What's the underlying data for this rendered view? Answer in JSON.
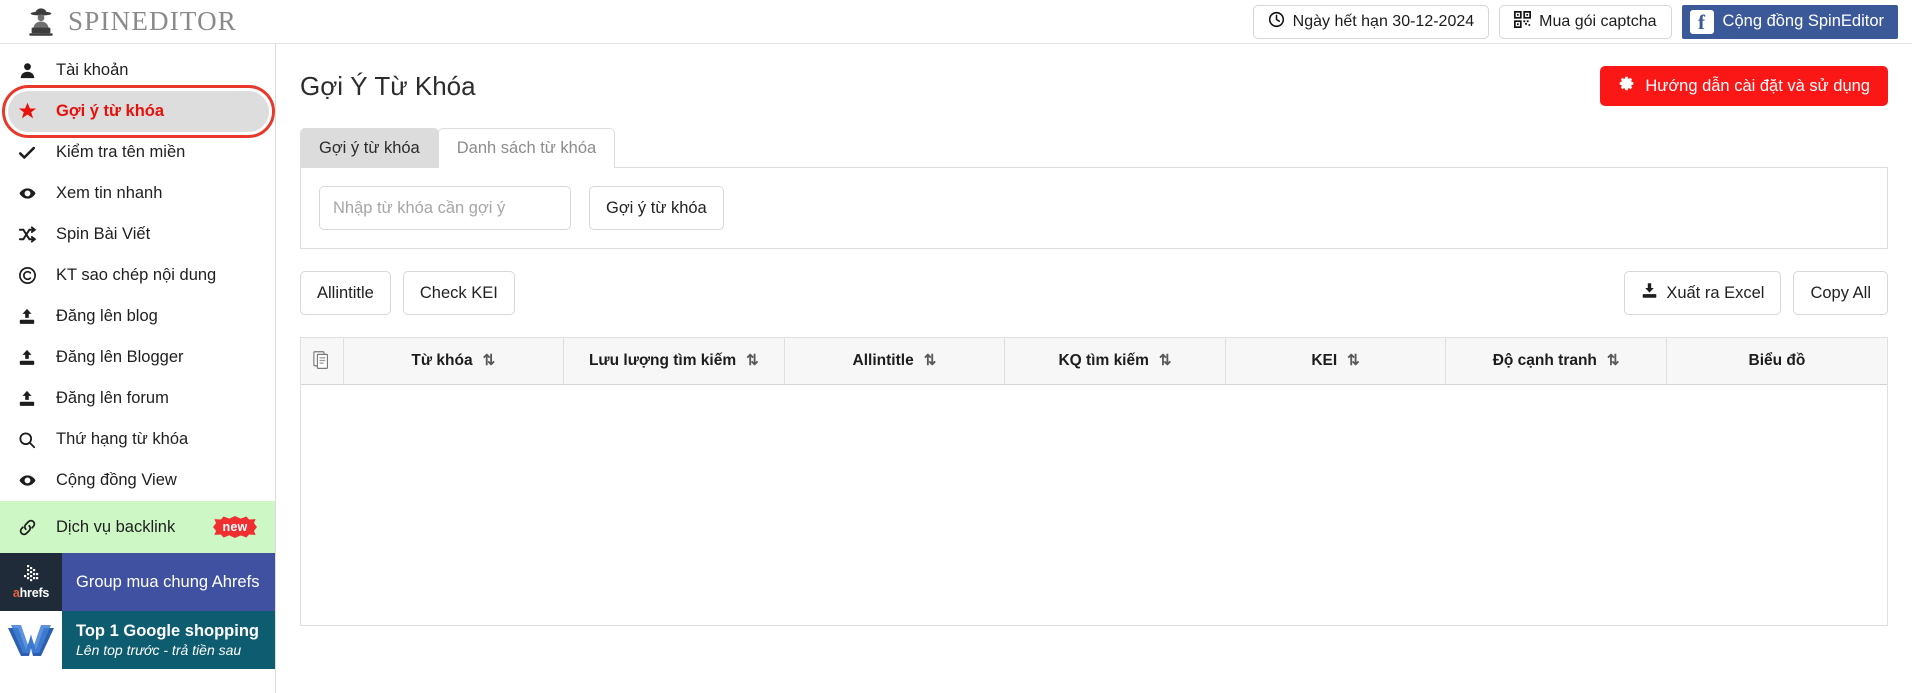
{
  "header": {
    "brand": "SPINEDITOR",
    "logo_icon": "spy-laptop-icon",
    "expiry_button": {
      "label": "Ngày hết hạn 30-12-2024",
      "icon": "clock-icon"
    },
    "captcha_button": {
      "label": "Mua gói captcha",
      "icon": "qr-code-icon"
    },
    "facebook_button": {
      "label": "Cộng đồng SpinEditor",
      "icon": "facebook-icon",
      "mark": "f",
      "color": "#3b5998"
    }
  },
  "sidebar": {
    "items": [
      {
        "label": "Tài khoản",
        "icon": "user-icon",
        "active": false
      },
      {
        "label": "Gợi ý từ khóa",
        "icon": "star-icon",
        "active": true
      },
      {
        "label": "Kiểm tra tên miền",
        "icon": "check-icon",
        "active": false
      },
      {
        "label": "Xem tin nhanh",
        "icon": "eye-icon",
        "active": false
      },
      {
        "label": "Spin Bài Viết",
        "icon": "shuffle-icon",
        "active": false
      },
      {
        "label": "KT sao chép nội dung",
        "icon": "copyright-icon",
        "active": false
      },
      {
        "label": "Đăng lên blog",
        "icon": "upload-icon",
        "active": false
      },
      {
        "label": "Đăng lên Blogger",
        "icon": "upload-icon",
        "active": false
      },
      {
        "label": "Đăng lên forum",
        "icon": "upload-icon",
        "active": false
      },
      {
        "label": "Thứ hạng từ khóa",
        "icon": "search-icon",
        "active": false
      },
      {
        "label": "Cộng đồng View",
        "icon": "eye-icon",
        "active": false
      }
    ],
    "active_color": "#e8100b",
    "backlink_promo": {
      "label": "Dịch vụ backlink",
      "icon": "link-icon",
      "badge": "new",
      "bg": "#cdf7c4"
    },
    "ahrefs_promo": {
      "label": "Group mua chung Ahrefs",
      "logo_text_a": "a",
      "logo_text_rest": "hrefs",
      "bg": "#3f51a0"
    },
    "w_promo": {
      "title": "Top 1 Google shopping",
      "subtitle": "Lên top trước - trả tiền sau",
      "bg": "#0d5c70",
      "logo_icon": "w-logo-icon"
    }
  },
  "main": {
    "page_title": "Gợi Ý Từ Khóa",
    "guide_button": {
      "label": "Hướng dẫn cài đặt và sử dụng",
      "icon": "gear-icon",
      "color": "#fc1717"
    },
    "tabs": [
      {
        "label": "Gợi ý từ khóa",
        "active": true
      },
      {
        "label": "Danh sách từ khóa",
        "active": false
      }
    ],
    "search": {
      "placeholder": "Nhập từ khóa cần gợi ý",
      "value": "",
      "submit_label": "Gợi ý từ khóa"
    },
    "toolbar": {
      "allintitle_label": "Allintitle",
      "check_kei_label": "Check KEI",
      "export_label": "Xuất ra Excel",
      "export_icon": "download-excel-icon",
      "copy_all_label": "Copy All"
    },
    "table": {
      "columns": [
        {
          "label": "",
          "icon": "document-copy-icon",
          "sortable": false
        },
        {
          "label": "Từ khóa",
          "sortable": true
        },
        {
          "label": "Lưu lượng tìm kiếm",
          "sortable": true
        },
        {
          "label": "Allintitle",
          "sortable": true
        },
        {
          "label": "KQ tìm kiếm",
          "sortable": true
        },
        {
          "label": "KEI",
          "sortable": true
        },
        {
          "label": "Độ cạnh tranh",
          "sortable": true
        },
        {
          "label": "Biểu đồ",
          "sortable": false
        }
      ],
      "rows": []
    }
  }
}
